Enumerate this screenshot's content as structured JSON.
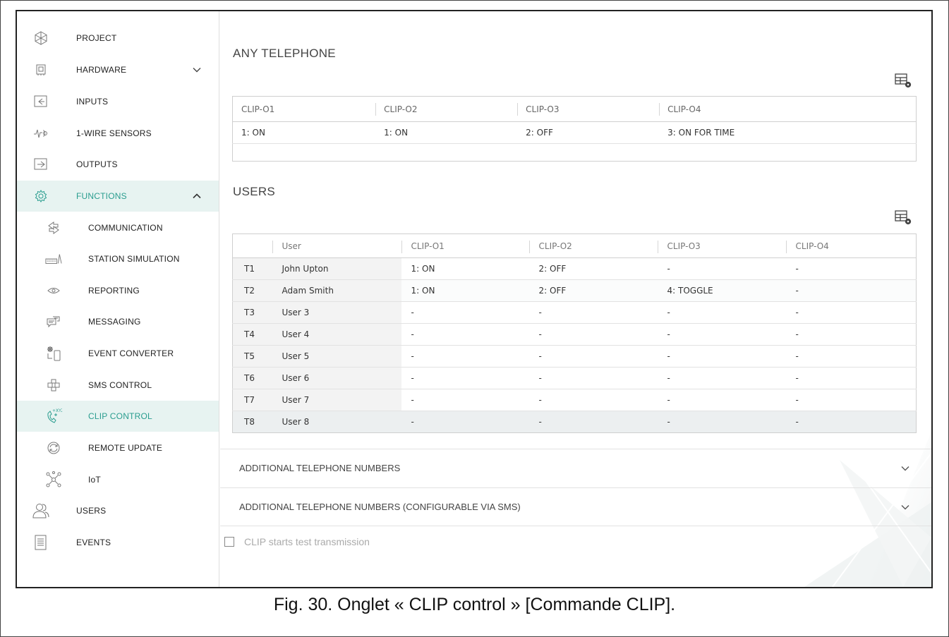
{
  "sidebar": {
    "items": [
      {
        "label": "PROJECT",
        "icon": "project-icon"
      },
      {
        "label": "HARDWARE",
        "icon": "hardware-icon"
      },
      {
        "label": "INPUTS",
        "icon": "inputs-icon"
      },
      {
        "label": "1-WIRE SENSORS",
        "icon": "sensor-icon"
      },
      {
        "label": "OUTPUTS",
        "icon": "outputs-icon"
      },
      {
        "label": "FUNCTIONS",
        "icon": "gear-icon"
      },
      {
        "label": "COMMUNICATION",
        "icon": "communication-icon"
      },
      {
        "label": "STATION SIMULATION",
        "icon": "station-icon"
      },
      {
        "label": "REPORTING",
        "icon": "eye-icon"
      },
      {
        "label": "MESSAGING",
        "icon": "message-icon"
      },
      {
        "label": "EVENT CONVERTER",
        "icon": "event-converter-icon"
      },
      {
        "label": "SMS CONTROL",
        "icon": "sms-control-icon"
      },
      {
        "label": "CLIP CONTROL",
        "icon": "clip-icon"
      },
      {
        "label": "REMOTE UPDATE",
        "icon": "update-icon"
      },
      {
        "label": "IoT",
        "icon": "iot-icon"
      },
      {
        "label": "USERS",
        "icon": "users-icon"
      },
      {
        "label": "EVENTS",
        "icon": "events-icon"
      }
    ],
    "accent_color": "#2a9d8f",
    "active_bg": "#e7f3f1"
  },
  "any_telephone": {
    "title": "ANY TELEPHONE",
    "columns": [
      "CLIP-O1",
      "CLIP-O2",
      "CLIP-O3",
      "CLIP-O4"
    ],
    "row": [
      "1: ON",
      "1: ON",
      "2: OFF",
      "3: ON FOR TIME"
    ]
  },
  "users": {
    "title": "USERS",
    "columns": [
      "",
      "User",
      "CLIP-O1",
      "CLIP-O2",
      "CLIP-O3",
      "CLIP-O4"
    ],
    "rows": [
      [
        "T1",
        "John Upton",
        "1: ON",
        "2: OFF",
        "-",
        "-"
      ],
      [
        "T2",
        "Adam Smith",
        "1: ON",
        "2: OFF",
        "4: TOGGLE",
        "-"
      ],
      [
        "T3",
        "User 3",
        "-",
        "-",
        "-",
        "-"
      ],
      [
        "T4",
        "User 4",
        "-",
        "-",
        "-",
        "-"
      ],
      [
        "T5",
        "User 5",
        "-",
        "-",
        "-",
        "-"
      ],
      [
        "T6",
        "User 6",
        "-",
        "-",
        "-",
        "-"
      ],
      [
        "T7",
        "User 7",
        "-",
        "-",
        "-",
        "-"
      ],
      [
        "T8",
        "User 8",
        "-",
        "-",
        "-",
        "-"
      ]
    ]
  },
  "accordions": [
    {
      "label": "ADDITIONAL TELEPHONE NUMBERS"
    },
    {
      "label": "ADDITIONAL TELEPHONE NUMBERS (CONFIGURABLE VIA SMS)"
    }
  ],
  "checkbox": {
    "label": "CLIP starts test transmission",
    "checked": false
  },
  "caption": "Fig. 30. Onglet « CLIP control » [Commande CLIP]."
}
